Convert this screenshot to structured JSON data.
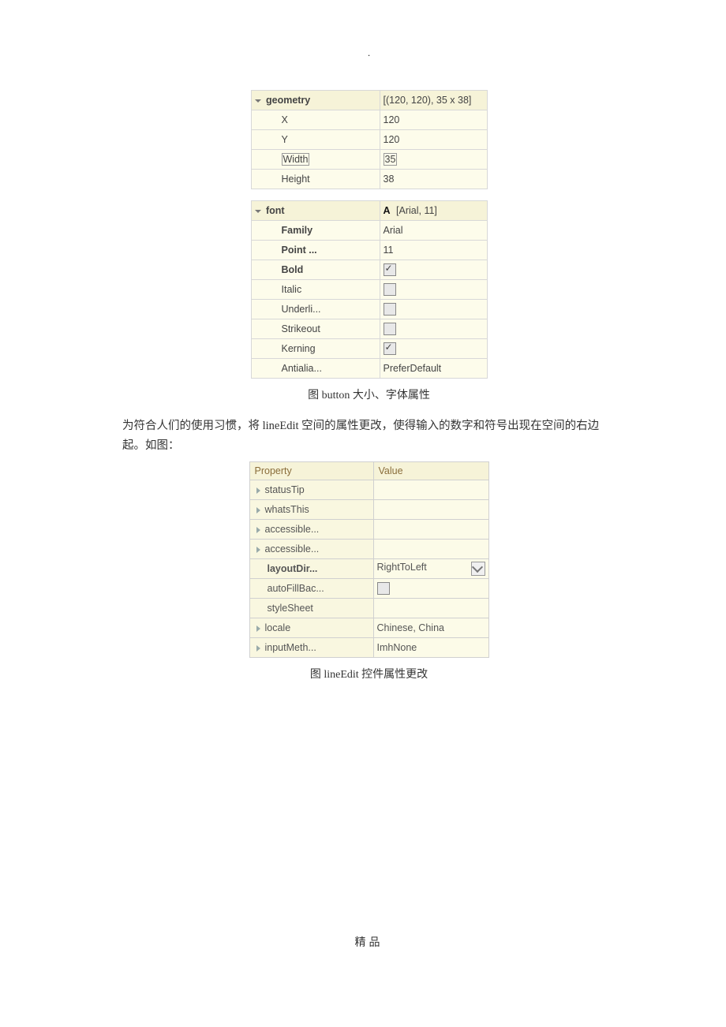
{
  "dot": ".",
  "geometry": {
    "header_label": "geometry",
    "header_value": "[(120, 120), 35 x 38]",
    "rows": [
      {
        "label": "X",
        "value": "120"
      },
      {
        "label": "Y",
        "value": "120"
      },
      {
        "label": "Width",
        "value": "35"
      },
      {
        "label": "Height",
        "value": "38"
      }
    ]
  },
  "font": {
    "header_label": "font",
    "header_value": "[Arial, 11]",
    "A": "A",
    "rows": [
      {
        "label": "Family",
        "value": "Arial",
        "bold": true
      },
      {
        "label": "Point ...",
        "value": "11",
        "bold": true
      },
      {
        "label": "Bold",
        "checkbox": true,
        "checked": true,
        "bold": true
      },
      {
        "label": "Italic",
        "checkbox": true,
        "checked": false
      },
      {
        "label": "Underli...",
        "checkbox": true,
        "checked": false,
        "brown": true
      },
      {
        "label": "Strikeout",
        "checkbox": true,
        "checked": false,
        "brown": true
      },
      {
        "label": "Kerning",
        "checkbox": true,
        "checked": true,
        "brown": true
      },
      {
        "label": "Antialia...",
        "value": "PreferDefault",
        "brown": true
      }
    ]
  },
  "caption1": "图  button 大小、字体属性",
  "paragraph": "为符合人们的使用习惯，将 lineEdit 空间的属性更改，使得输入的数字和符号出现在空间的右边起。如图：",
  "ptable": {
    "col_a": "Property",
    "col_b": "Value",
    "rows": [
      {
        "label": "statusTip",
        "value": "",
        "caret": true,
        "brown": true
      },
      {
        "label": "whatsThis",
        "value": "",
        "caret": true,
        "brown": true
      },
      {
        "label": "accessible...",
        "value": "",
        "caret": true,
        "brown": true
      },
      {
        "label": "accessible...",
        "value": "",
        "caret": true,
        "brown": true
      },
      {
        "label": "layoutDir...",
        "value": "RightToLeft",
        "bold": true,
        "indent": true,
        "reset": true
      },
      {
        "label": "autoFillBac...",
        "checkbox": true,
        "indent": true,
        "brown": true
      },
      {
        "label": "styleSheet",
        "value": "",
        "indent": true,
        "brown": true
      },
      {
        "label": "locale",
        "value": "Chinese, China",
        "caret": true,
        "brown": true
      },
      {
        "label": "inputMeth...",
        "value": "ImhNone",
        "caret": true,
        "brown": true
      }
    ]
  },
  "caption2": "图  lineEdit 控件属性更改",
  "footer": "精品"
}
